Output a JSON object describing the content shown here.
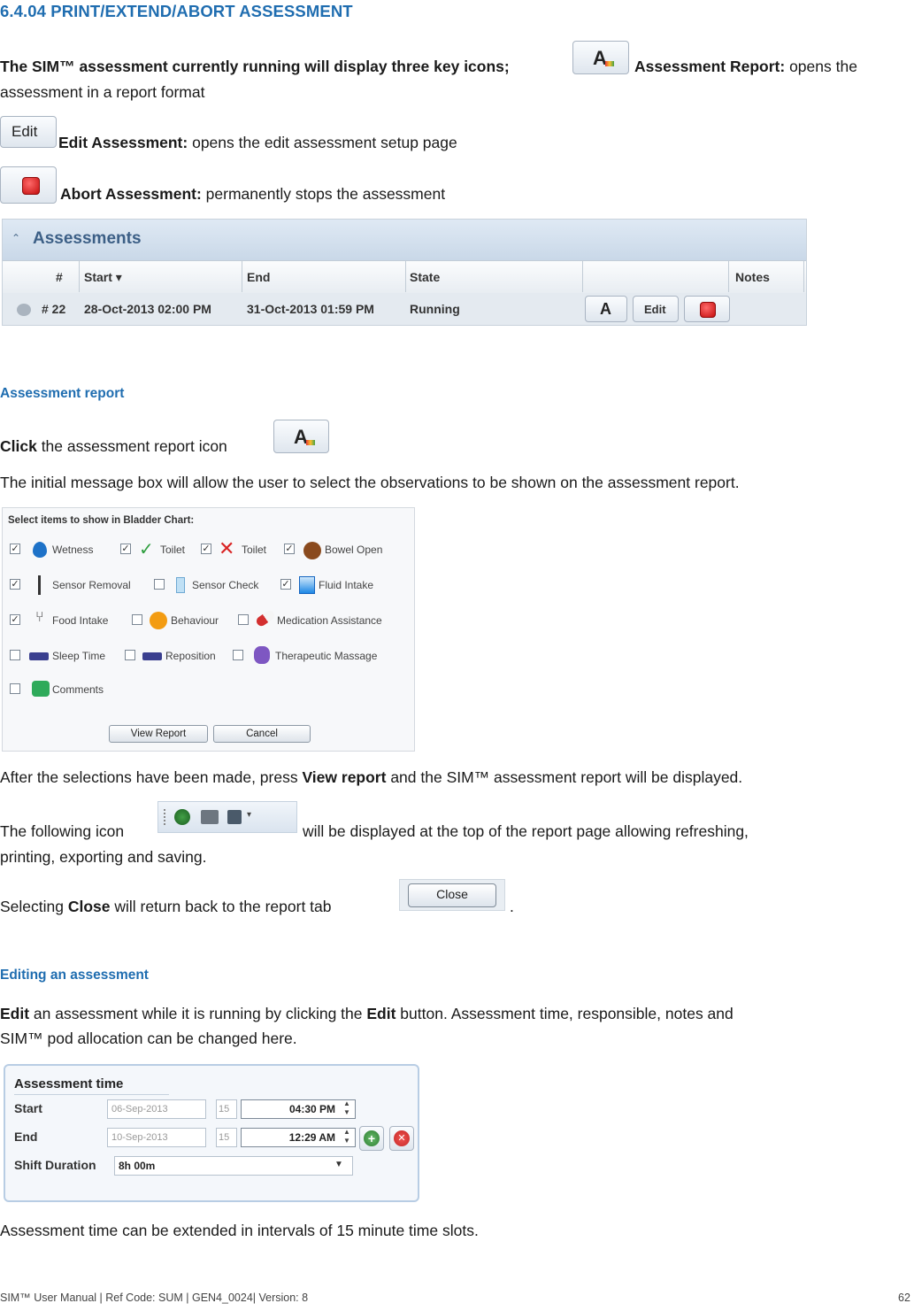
{
  "heading": "6.4.04 PRINT/EXTEND/ABORT ASSESSMENT",
  "intro": {
    "lead": "The SIM™ assessment currently running will display three key icons;",
    "report_bold": "Assessment Report:",
    "report_text": " opens the",
    "report_text2": "assessment in a report format",
    "edit_btn": "Edit",
    "edit_bold": "Edit Assessment:",
    "edit_text": " opens the edit assessment setup page",
    "abort_bold": "Abort Assessment:",
    "abort_text": " permanently stops the assessment"
  },
  "assessments_grid": {
    "title": "Assessments",
    "columns": [
      "#",
      "Start ▾",
      "End",
      "State",
      "Notes"
    ],
    "row": {
      "id": "# 22",
      "start": "28-Oct-2013 02:00 PM",
      "end": "31-Oct-2013 01:59 PM",
      "state": "Running",
      "edit_label": "Edit"
    }
  },
  "section_report": {
    "heading": "Assessment report",
    "click_bold": "Click",
    "click_text": " the assessment report icon",
    "para": "The initial message box will allow the user to select the observations to be shown on the assessment report."
  },
  "bladder_dialog": {
    "title": "Select items to show in Bladder Chart:",
    "items": [
      {
        "label": "Wetness",
        "checked": "✓"
      },
      {
        "label": "Toilet",
        "checked": "✓"
      },
      {
        "label": "Toilet",
        "checked": "✓"
      },
      {
        "label": "Bowel Open",
        "checked": "✓"
      },
      {
        "label": "Sensor Removal",
        "checked": "✓"
      },
      {
        "label": "Sensor Check",
        "checked": ""
      },
      {
        "label": "Fluid Intake",
        "checked": "✓"
      },
      {
        "label": "Food Intake",
        "checked": "✓"
      },
      {
        "label": "Behaviour",
        "checked": ""
      },
      {
        "label": "Medication Assistance",
        "checked": ""
      },
      {
        "label": "Sleep Time",
        "checked": ""
      },
      {
        "label": "Reposition",
        "checked": ""
      },
      {
        "label": "Therapeutic Massage",
        "checked": ""
      },
      {
        "label": "Comments",
        "checked": ""
      }
    ],
    "view_report": "View Report",
    "cancel": "Cancel"
  },
  "after": {
    "p1_pre": "After the selections have been made, press ",
    "p1_bold": "View report",
    "p1_post": " and the SIM™ assessment report will be displayed.",
    "p2_pre": "The following icon",
    "p2_post": " will be displayed at the top of the report page allowing refreshing,",
    "p2_line2": "printing, exporting and saving.",
    "p3_pre": "Selecting ",
    "p3_bold": "Close",
    "p3_post": " will return back to the report tab",
    "p3_end": ".",
    "close_btn": "Close"
  },
  "section_edit": {
    "heading": "Editing an assessment",
    "bold": "Edit",
    "text1": " an assessment while it is running by clicking the ",
    "bold2": "Edit",
    "text2": " button. Assessment time, responsible, notes and",
    "line2": "SIM™ pod allocation can be changed here."
  },
  "time_panel": {
    "title": "Assessment time",
    "start_label": "Start",
    "end_label": "End",
    "shift_label": "Shift Duration",
    "start_date": "06-Sep-2013",
    "end_date": "10-Sep-2013",
    "cal": "15",
    "start_time": "04:30 PM",
    "end_time": "12:29 AM",
    "shift_value": "8h 00m"
  },
  "closing": "Assessment time can be extended in intervals of 15 minute time slots.",
  "footer": {
    "left": "SIM™ User Manual | Ref Code: SUM | GEN4_0024| Version: 8",
    "page": "62"
  }
}
